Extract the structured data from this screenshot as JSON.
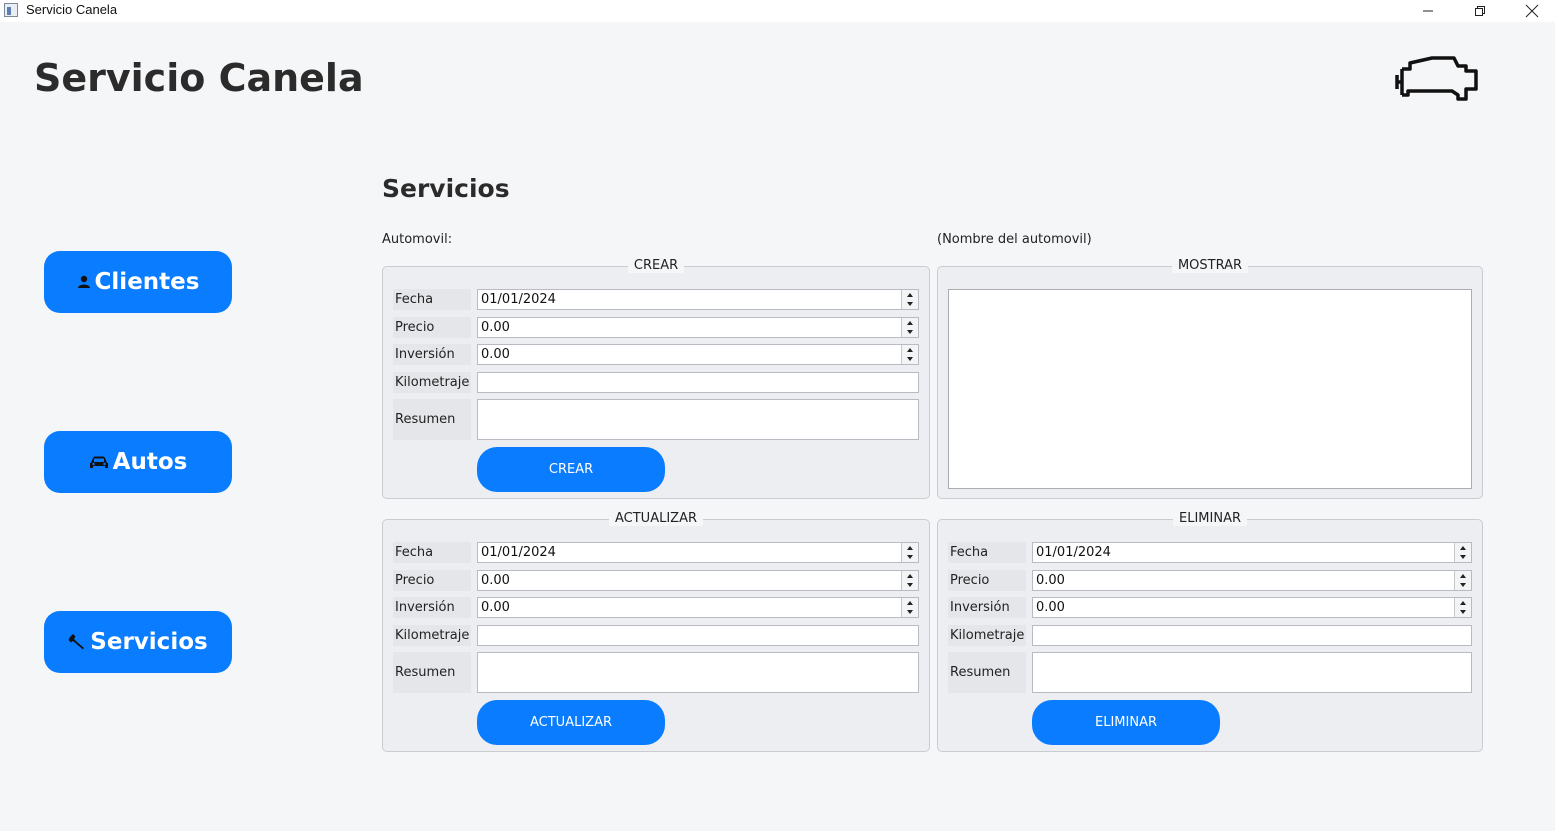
{
  "window": {
    "title": "Servicio Canela"
  },
  "header": {
    "title": "Servicio Canela",
    "logo_icon": "engine-icon"
  },
  "sidebar": {
    "clientes": {
      "label": "Clientes",
      "icon": "person-icon"
    },
    "autos": {
      "label": "Autos",
      "icon": "car-icon"
    },
    "servicios": {
      "label": "Servicios",
      "icon": "wrench-icon"
    }
  },
  "main": {
    "title": "Servicios",
    "automovil_label": "Automovil:",
    "automovil_name": "(Nombre del automovil)"
  },
  "crear": {
    "title": "CREAR",
    "labels": {
      "fecha": "Fecha",
      "precio": "Precio",
      "inversion": "Inversión",
      "kilometraje": "Kilometraje",
      "resumen": "Resumen"
    },
    "values": {
      "fecha": "01/01/2024",
      "precio": "0.00",
      "inversion": "0.00",
      "kilometraje": "",
      "resumen": ""
    },
    "button": "CREAR"
  },
  "mostrar": {
    "title": "MOSTRAR",
    "content": ""
  },
  "actualizar": {
    "title": "ACTUALIZAR",
    "labels": {
      "fecha": "Fecha",
      "precio": "Precio",
      "inversion": "Inversión",
      "kilometraje": "Kilometraje",
      "resumen": "Resumen"
    },
    "values": {
      "fecha": "01/01/2024",
      "precio": "0.00",
      "inversion": "0.00",
      "kilometraje": "",
      "resumen": ""
    },
    "button": "ACTUALIZAR"
  },
  "eliminar": {
    "title": "ELIMINAR",
    "labels": {
      "fecha": "Fecha",
      "precio": "Precio",
      "inversion": "Inversión",
      "kilometraje": "Kilometraje",
      "resumen": "Resumen"
    },
    "values": {
      "fecha": "01/01/2024",
      "precio": "0.00",
      "inversion": "0.00",
      "kilometraje": "",
      "resumen": ""
    },
    "button": "ELIMINAR"
  },
  "colors": {
    "accent": "#0a7cff",
    "background": "#f5f6f8",
    "group_bg": "#eceef1"
  }
}
